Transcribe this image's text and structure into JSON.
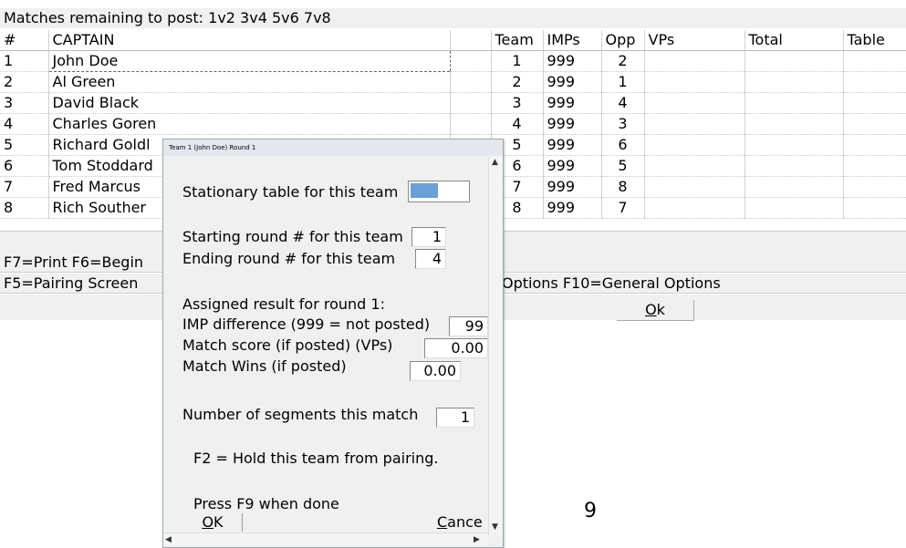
{
  "header": {
    "text": "Matches remaining to post: 1v2 3v4 5v6 7v8"
  },
  "table": {
    "columns": [
      "#",
      "CAPTAIN",
      "",
      "Team",
      "IMPs",
      "Opp",
      "VPs",
      "Total",
      "Table"
    ],
    "rows": [
      {
        "num": "1",
        "captain": "John Doe",
        "team": "1",
        "imps": "999",
        "opp": "2"
      },
      {
        "num": "2",
        "captain": "Al Green",
        "team": "2",
        "imps": "999",
        "opp": "1"
      },
      {
        "num": "3",
        "captain": "David Black",
        "team": "3",
        "imps": "999",
        "opp": "4"
      },
      {
        "num": "4",
        "captain": "Charles Goren",
        "team": "4",
        "imps": "999",
        "opp": "3"
      },
      {
        "num": "5",
        "captain": "Richard Goldl",
        "team": "5",
        "imps": "999",
        "opp": "6"
      },
      {
        "num": "6",
        "captain": "Tom Stoddard",
        "team": "6",
        "imps": "999",
        "opp": "5"
      },
      {
        "num": "7",
        "captain": "Fred Marcus",
        "team": "7",
        "imps": "999",
        "opp": "8"
      },
      {
        "num": "8",
        "captain": "Rich Souther",
        "team": "8",
        "imps": "999",
        "opp": "7"
      }
    ]
  },
  "footer": {
    "line1": "F7=Print  F6=Begin",
    "line2_left": "F5=Pairing Screen",
    "line2_right": "Options  F10=General Options",
    "ok_label": "Ok",
    "ok_mnemonic": "O",
    "ok_rest": "k"
  },
  "page_number": "9",
  "dialog": {
    "title": "Team 1 (John Doe) Round 1",
    "stationary_label": "Stationary table for this team",
    "starting_label": "Starting round # for this team",
    "starting_value": "1",
    "ending_label": "Ending round # for this team",
    "ending_value": "4",
    "assigned_label": "Assigned result for round 1:",
    "imp_label": "IMP difference (999 = not posted)",
    "imp_value": "99",
    "match_score_label": "Match score (if posted) (VPs)",
    "match_score_value": "0.00",
    "match_wins_label": "Match Wins (if posted)",
    "match_wins_value": "0.00",
    "segments_label": "Number of segments this match",
    "segments_value": "1",
    "hold_text": "F2 = Hold this team from pairing.",
    "press_text": "Press F9 when done",
    "ok_mnemonic": "O",
    "ok_rest": "K",
    "cancel_mnemonic": "C",
    "cancel_rest": "ance"
  },
  "colors": {
    "selection": "#6aa0d8",
    "panel": "#f0f0f0"
  }
}
